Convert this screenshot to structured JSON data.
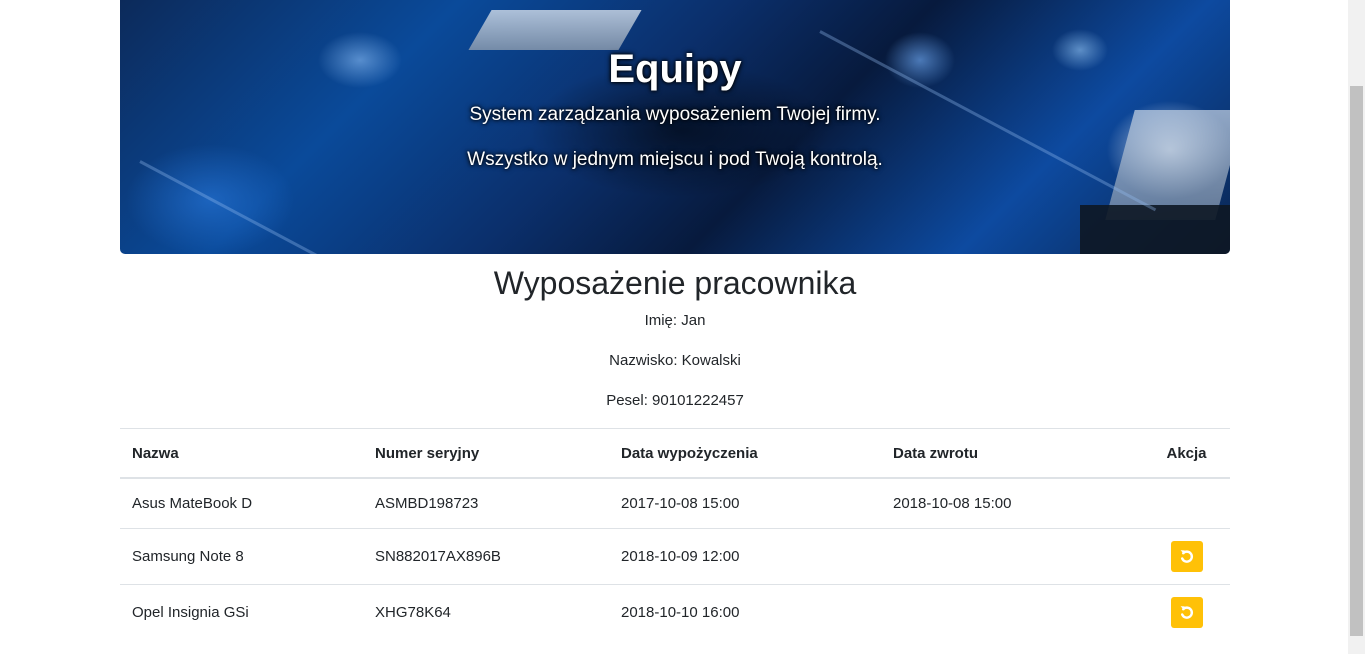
{
  "hero": {
    "title": "Equipy",
    "line1": "System zarządzania wyposażeniem Twojej firmy.",
    "line2": "Wszystko w jednym miejscu i pod Twoją kontrolą."
  },
  "employee": {
    "heading": "Wyposażenie pracownika",
    "first_name": "Imię: Jan",
    "last_name": "Nazwisko: Kowalski",
    "pesel": "Pesel: 90101222457"
  },
  "table": {
    "headers": [
      "Nazwa",
      "Numer seryjny",
      "Data wypożyczenia",
      "Data zwrotu",
      "Akcja"
    ],
    "rows": [
      {
        "name": "Asus MateBook D",
        "serial": "ASMBD198723",
        "rented": "2017-10-08 15:00",
        "returned": "2018-10-08 15:00",
        "action": "none"
      },
      {
        "name": "Samsung Note 8",
        "serial": "SN882017AX896B",
        "rented": "2018-10-09 12:00",
        "returned": "",
        "action": "undo-icon"
      },
      {
        "name": "Opel Insignia GSi",
        "serial": "XHG78K64",
        "rented": "2018-10-10 16:00",
        "returned": "",
        "action": "undo-icon"
      }
    ]
  },
  "colors": {
    "action_button": "#ffc107",
    "border": "#dee2e6",
    "text": "#212529"
  }
}
